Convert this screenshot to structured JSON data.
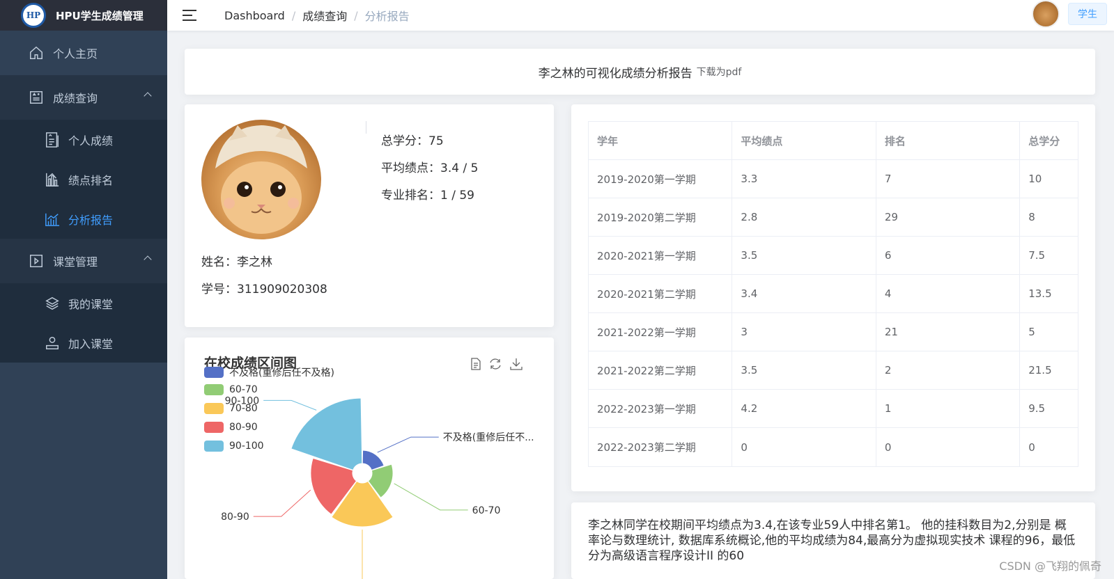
{
  "app": {
    "title": "HPU学生成绩管理",
    "logo_text": "HP"
  },
  "sidebar": {
    "items": [
      {
        "label": "个人主页",
        "icon": "home-icon"
      },
      {
        "label": "成绩查询",
        "icon": "document-grade-icon",
        "expanded": true,
        "children": [
          {
            "label": "个人成绩",
            "icon": "report-icon"
          },
          {
            "label": "绩点排名",
            "icon": "bar-chart-icon"
          },
          {
            "label": "分析报告",
            "icon": "line-chart-icon",
            "active": true
          }
        ]
      },
      {
        "label": "课堂管理",
        "icon": "play-square-icon",
        "expanded": true,
        "children": [
          {
            "label": "我的课堂",
            "icon": "layers-icon"
          },
          {
            "label": "加入课堂",
            "icon": "user-icon"
          }
        ]
      }
    ]
  },
  "header": {
    "breadcrumb": [
      "Dashboard",
      "成绩查询",
      "分析报告"
    ],
    "role": "学生"
  },
  "report": {
    "title": "李之林的可视化成绩分析报告",
    "download": "下载为pdf"
  },
  "profile": {
    "total_credits": "总学分：75",
    "avg_gpa": "平均绩点：3.4 / 5",
    "rank": "专业排名：1 / 59",
    "name": "姓名：李之林",
    "student_id": "学号：311909020308"
  },
  "table": {
    "headers": [
      "学年",
      "平均绩点",
      "排名",
      "总学分"
    ],
    "rows": [
      [
        "2019-2020第一学期",
        "3.3",
        "7",
        "10"
      ],
      [
        "2019-2020第二学期",
        "2.8",
        "29",
        "8"
      ],
      [
        "2020-2021第一学期",
        "3.5",
        "6",
        "7.5"
      ],
      [
        "2020-2021第二学期",
        "3.4",
        "4",
        "13.5"
      ],
      [
        "2021-2022第一学期",
        "3",
        "21",
        "5"
      ],
      [
        "2021-2022第二学期",
        "3.5",
        "2",
        "21.5"
      ],
      [
        "2022-2023第一学期",
        "4.2",
        "1",
        "9.5"
      ],
      [
        "2022-2023第二学期",
        "0",
        "0",
        "0"
      ]
    ]
  },
  "chart_data": {
    "type": "pie",
    "variant": "rose",
    "title": "在校成绩区间图",
    "categories": [
      "不及格(重修后任不及格)",
      "60-70",
      "70-80",
      "80-90",
      "90-100"
    ],
    "values": [
      2,
      5,
      22,
      20,
      49
    ],
    "colors": [
      "#5470c6",
      "#91cc75",
      "#fac858",
      "#ee6666",
      "#73c0de"
    ],
    "labels": [
      "不及格(重修后任不...",
      "60-70",
      "70-80",
      "80-90",
      "90-100"
    ],
    "legend_position": "top-left"
  },
  "summary": "李之林同学在校期间平均绩点为3.4,在该专业59人中排名第1。 他的挂科数目为2,分别是 概率论与数理统计, 数据库系统概论,他的平均成绩为84,最高分为虚拟现实技术 课程的96，最低分为高级语言程序设计II 的60",
  "watermark": "CSDN @飞翔的佩奇"
}
